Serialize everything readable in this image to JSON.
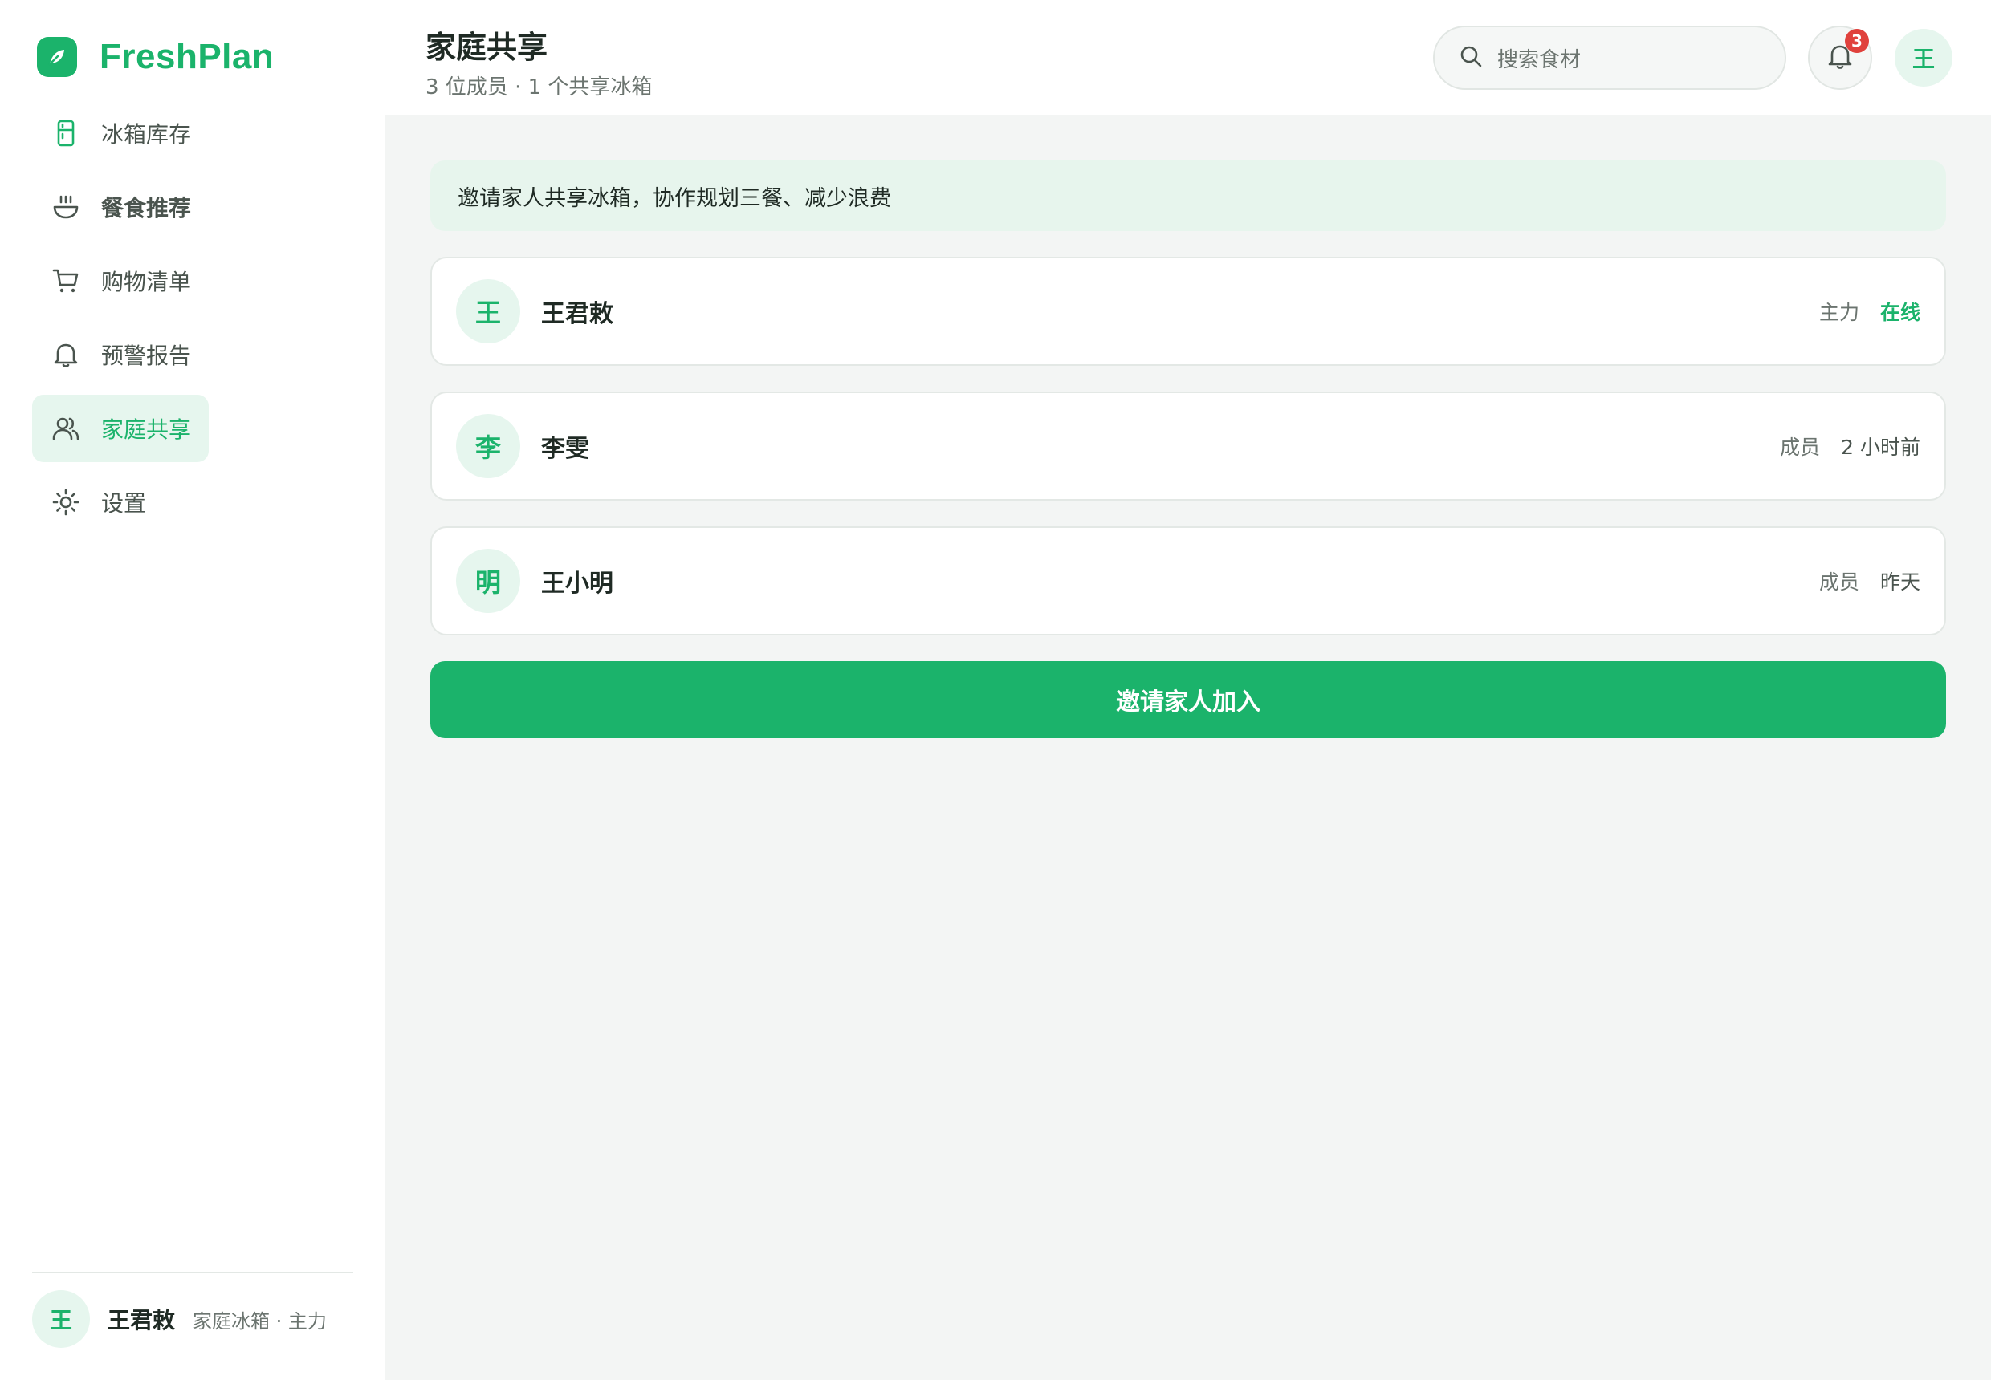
{
  "app": {
    "name": "FreshPlan",
    "brand_color": "#1bb36b"
  },
  "sidebar": {
    "items": [
      {
        "label": "冰箱库存",
        "icon": "fridge-icon"
      },
      {
        "label": "餐食推荐",
        "icon": "bowl-icon"
      },
      {
        "label": "购物清单",
        "icon": "cart-icon"
      },
      {
        "label": "预警报告",
        "icon": "bell-icon"
      },
      {
        "label": "家庭共享",
        "icon": "users-icon",
        "active": true
      },
      {
        "label": "设置",
        "icon": "sun-gear-icon"
      }
    ],
    "user": {
      "initial": "王",
      "name": "王君敕",
      "meta": "家庭冰箱 · 主力"
    }
  },
  "header": {
    "title": "家庭共享",
    "subtitle": "3 位成员 · 1 个共享冰箱",
    "search_placeholder": "搜索食材",
    "notification_count": "3",
    "avatar_initial": "王"
  },
  "banner": {
    "text": "邀请家人共享冰箱，协作规划三餐、减少浪费"
  },
  "members": [
    {
      "initial": "王",
      "name": "王君敕",
      "role": "主力",
      "status": "在线",
      "online": true
    },
    {
      "initial": "李",
      "name": "李雯",
      "role": "成员",
      "status": "2 小时前",
      "online": false
    },
    {
      "initial": "明",
      "name": "王小明",
      "role": "成员",
      "status": "昨天",
      "online": false
    }
  ],
  "invite_button": {
    "label": "邀请家人加入"
  }
}
